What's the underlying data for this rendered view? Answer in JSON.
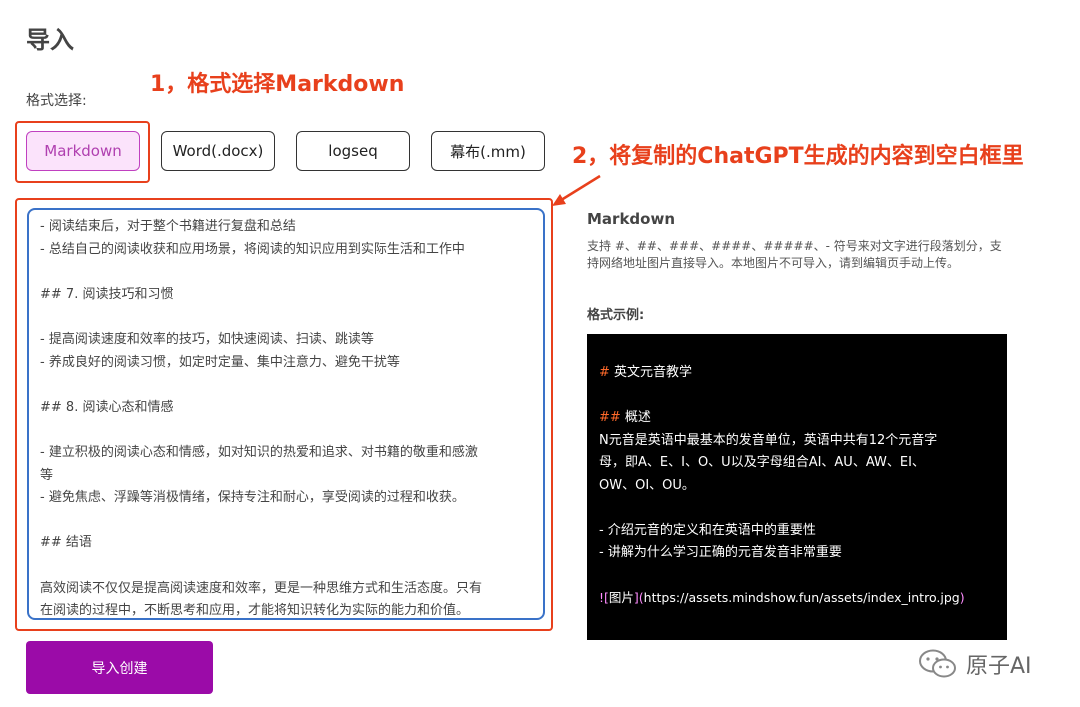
{
  "page": {
    "title": "导入"
  },
  "annotations": {
    "step1": "1，格式选择Markdown",
    "step2": "2，将复制的ChatGPT生成的内容到空白框里"
  },
  "format": {
    "label": "格式选择:",
    "options": [
      "Markdown",
      "Word(.docx)",
      "logseq",
      "幕布(.mm)"
    ],
    "selected": "Markdown"
  },
  "editor": {
    "lines": [
      "- 阅读结束后，对于整个书籍进行复盘和总结",
      "- 总结自己的阅读收获和应用场景，将阅读的知识应用到实际生活和工作中",
      "",
      "## 7. 阅读技巧和习惯",
      "",
      "- 提高阅读速度和效率的技巧，如快速阅读、扫读、跳读等",
      "- 养成良好的阅读习惯，如定时定量、集中注意力、避免干扰等",
      "",
      "## 8. 阅读心态和情感",
      "",
      "- 建立积极的阅读心态和情感，如对知识的热爱和追求、对书籍的敬重和感激",
      "等",
      "- 避免焦虑、浮躁等消极情绪，保持专注和耐心，享受阅读的过程和收获。",
      "",
      "## 结语",
      "",
      "高效阅读不仅仅是提高阅读速度和效率，更是一种思维方式和生活态度。只有",
      "在阅读的过程中，不断思考和应用，才能将知识转化为实际的能力和价值。"
    ]
  },
  "import_button": {
    "label": "导入创建"
  },
  "help": {
    "title": "Markdown",
    "description": "支持 #、##、###、####、#####、- 符号来对文字进行段落划分，支持网络地址图片直接导入。本地图片不可导入，请到编辑页手动上传。",
    "example_label": "格式示例:",
    "example": {
      "h1_mark": "#",
      "h1_text": " 英文元音教学",
      "h2_mark": "##",
      "h2_text": " 概述",
      "para_lines": [
        " N元音是英语中最基本的发音单位，英语中共有12个元音字",
        "母，即A、E、I、O、U以及字母组合AI、AU、AW、EI、",
        "OW、OI、OU。"
      ],
      "bullets": [
        "- 介绍元音的定义和在英语中的重要性",
        "- 讲解为什么学习正确的元音发音非常重要"
      ],
      "image_open": "![",
      "image_alt": "图片",
      "image_mid": "](",
      "image_url": "https://assets.mindshow.fun/assets/index_intro.jpg",
      "image_close": ")"
    }
  },
  "watermark": {
    "text": "原子AI",
    "icon": "wechat-icon"
  },
  "colors": {
    "accent": "#9b0ba8",
    "annotation": "#e8401c",
    "editor_border": "#3a72c8"
  }
}
